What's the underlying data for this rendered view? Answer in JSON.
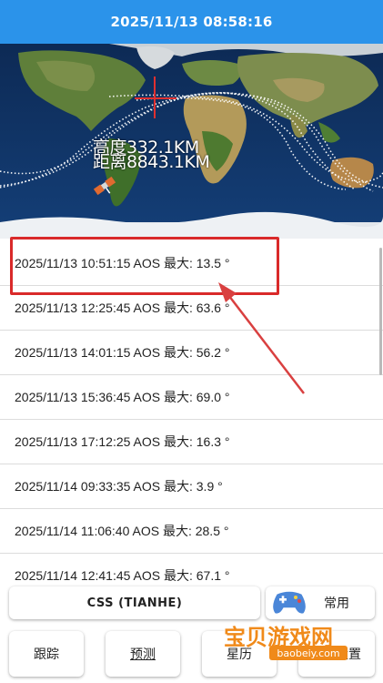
{
  "header": {
    "datetime": "2025/11/13 08:58:16"
  },
  "map": {
    "altitude": "高度332.1KM",
    "distance": "距离8843.1KM"
  },
  "passes": [
    "2025/11/13 10:51:15 AOS 最大: 13.5 °",
    "2025/11/13 12:25:45 AOS 最大: 63.6 °",
    "2025/11/13 14:01:15 AOS 最大: 56.2 °",
    "2025/11/13 15:36:45 AOS 最大: 69.0 °",
    "2025/11/13 17:12:25 AOS 最大: 16.3 °",
    "2025/11/14 09:33:35 AOS 最大:  3.9 °",
    "2025/11/14 11:06:40 AOS 最大: 28.5 °",
    "2025/11/14 12:41:45 AOS 最大: 67.1 °"
  ],
  "buttons": {
    "satellite": "CSS (TIANHE)",
    "common": "常用",
    "track": "跟踪",
    "predict": "预测",
    "star": "星历",
    "settings": "设置"
  },
  "watermark": {
    "title": "宝贝游戏网",
    "url": "baobeiy.com"
  },
  "colors": {
    "header": "#2b93ea",
    "highlight": "#d92a2a",
    "watermark": "#f08a1a"
  }
}
